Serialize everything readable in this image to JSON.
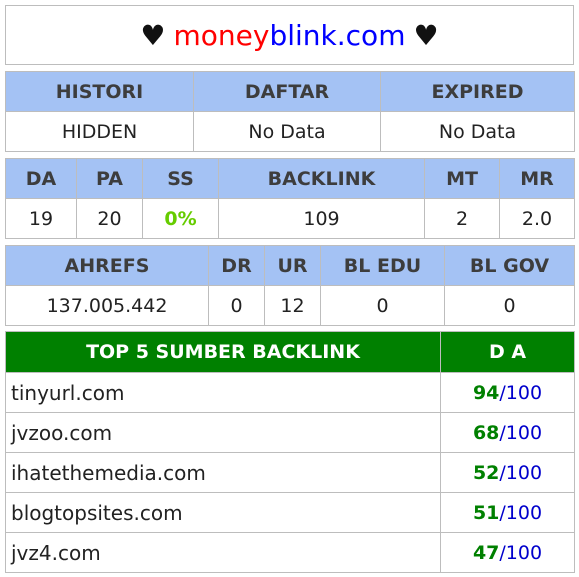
{
  "title": {
    "prefix_heart": "♥",
    "part1": "money",
    "part2": "blink.com",
    "suffix_heart": "♥"
  },
  "table1": {
    "headers": [
      "HISTORI",
      "DAFTAR",
      "EXPIRED"
    ],
    "values": [
      "HIDDEN",
      "No Data",
      "No Data"
    ]
  },
  "table2": {
    "headers": [
      "DA",
      "PA",
      "SS",
      "BACKLINK",
      "MT",
      "MR"
    ],
    "values": [
      "19",
      "20",
      "0%",
      "109",
      "2",
      "2.0"
    ]
  },
  "table3": {
    "headers": [
      "AHREFS",
      "DR",
      "UR",
      "BL EDU",
      "BL GOV"
    ],
    "values": [
      "137.005.442",
      "0",
      "12",
      "0",
      "0"
    ]
  },
  "table4": {
    "headers": [
      "TOP 5 SUMBER BACKLINK",
      "D A"
    ],
    "rows": [
      {
        "site": "tinyurl.com",
        "da": "94",
        "max": "/100"
      },
      {
        "site": "jvzoo.com",
        "da": "68",
        "max": "/100"
      },
      {
        "site": "ihatethemedia.com",
        "da": "52",
        "max": "/100"
      },
      {
        "site": "blogtopsites.com",
        "da": "51",
        "max": "/100"
      },
      {
        "site": "jvz4.com",
        "da": "47",
        "max": "/100"
      }
    ]
  },
  "colors": {
    "header_bg": "#a4c2f4",
    "top5_header_bg": "#008000",
    "ss_value": "#66cc00",
    "brand_red": "#ff0000",
    "brand_blue": "#0000ff"
  }
}
